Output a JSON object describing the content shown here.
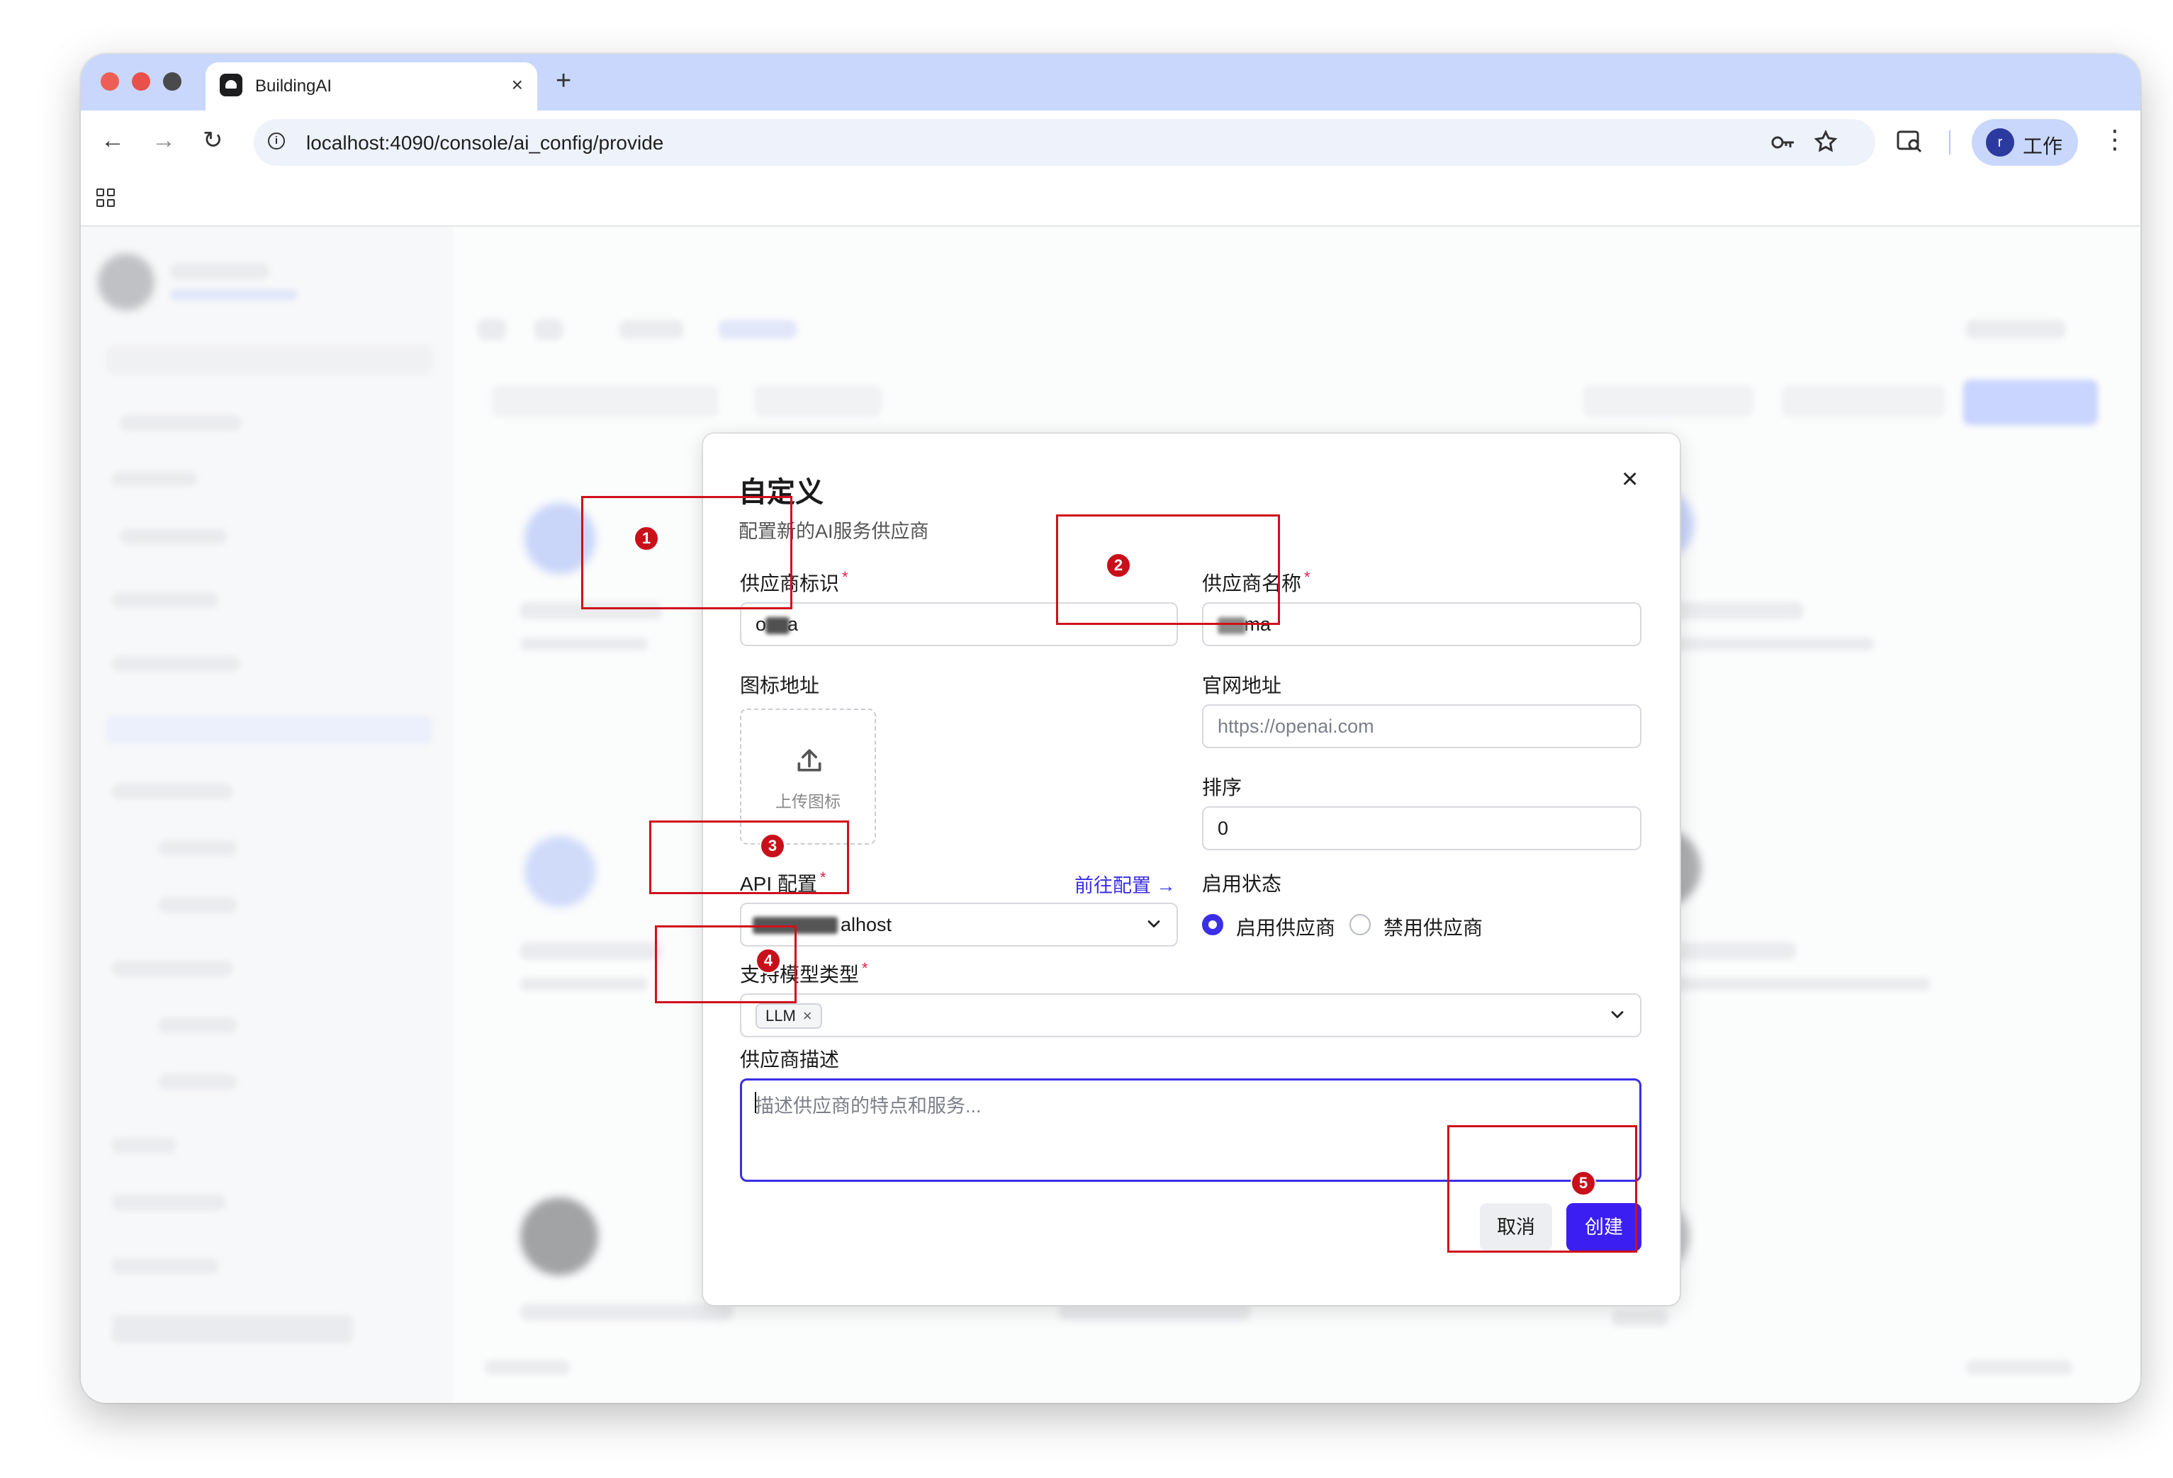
{
  "browser": {
    "tab_title": "BuildingAI",
    "tab_close": "×",
    "new_tab": "+",
    "url": "localhost:4090/console/ai_config/provide",
    "profile_initial": "r",
    "profile_label": "工作",
    "colors": {
      "titlebar": "#c8d7fb",
      "traffic_red": "#ee5e57",
      "traffic_yellow": "#e9504c",
      "traffic_gray": "#4a4a4c"
    }
  },
  "dialog": {
    "title": "自定义",
    "subtitle": "配置新的AI服务供应商",
    "close": "×",
    "provider_id": {
      "label": "供应商标识",
      "required_mark": "*",
      "value": "o    a"
    },
    "provider_name": {
      "label": "供应商名称",
      "required_mark": "*",
      "value": "     ma"
    },
    "icon_url": {
      "label": "图标地址",
      "upload_text": "上传图标"
    },
    "website": {
      "label": "官网地址",
      "placeholder": "https://openai.com"
    },
    "sort": {
      "label": "排序",
      "value": "0"
    },
    "api_config": {
      "label": "API 配置",
      "required_mark": "*",
      "value": "alhost",
      "link": "前往配置"
    },
    "status": {
      "label": "启用状态",
      "options": [
        "启用供应商",
        "禁用供应商"
      ],
      "selected": "启用供应商"
    },
    "model_types": {
      "label": "支持模型类型",
      "required_mark": "*",
      "selected": [
        "LLM"
      ]
    },
    "description": {
      "label": "供应商描述",
      "placeholder": "描述供应商的特点和服务..."
    },
    "cancel": "取消",
    "create": "创建",
    "accent_color": "#3b2ee6"
  },
  "annotations": [
    "1",
    "2",
    "3",
    "4",
    "5"
  ],
  "annotation_color": "#d0101b"
}
